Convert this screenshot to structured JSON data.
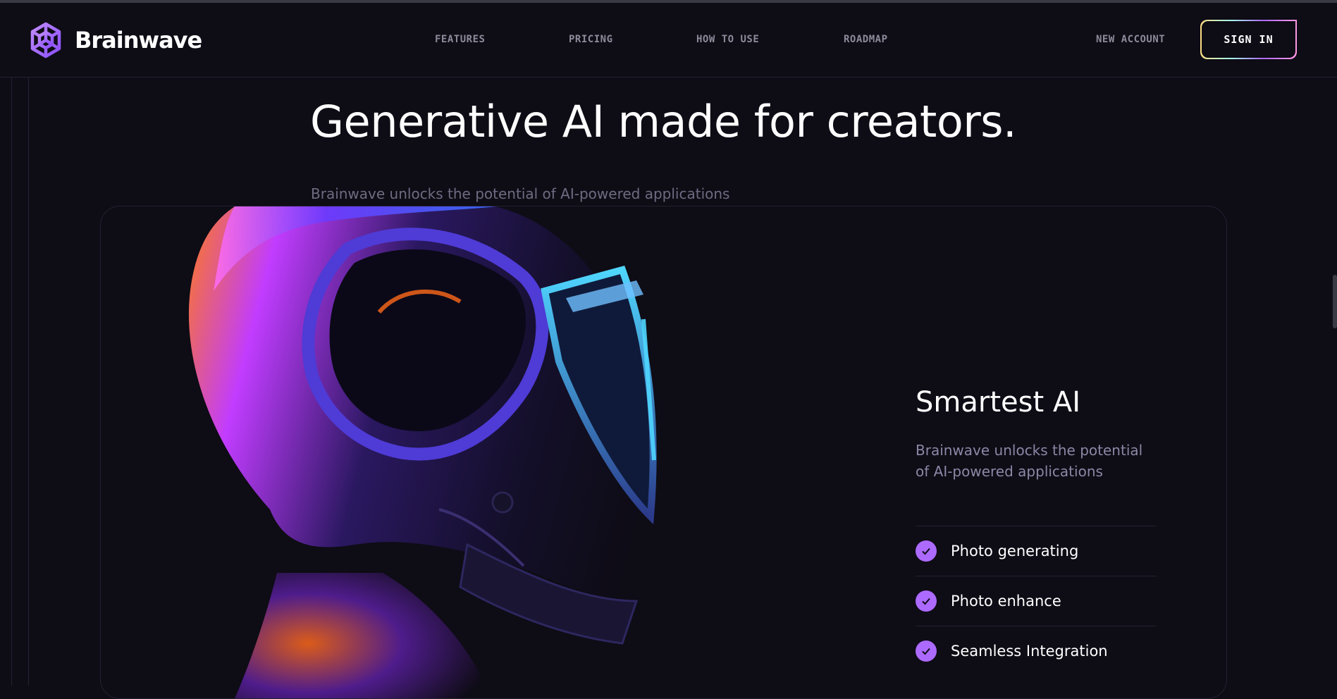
{
  "brand": {
    "name": "Brainwave",
    "accent": "#ac6aff"
  },
  "nav": {
    "items": [
      {
        "label": "FEATURES"
      },
      {
        "label": "PRICING"
      },
      {
        "label": "HOW TO USE"
      },
      {
        "label": "ROADMAP"
      }
    ],
    "new_account": "NEW ACCOUNT",
    "sign_in": "SIGN IN"
  },
  "hero": {
    "title": "Generative AI made for creators.",
    "subtitle": "Brainwave unlocks the potential of AI-powered applications"
  },
  "feature": {
    "title": "Smartest AI",
    "text": "Brainwave unlocks the potential of AI-powered applications",
    "items": [
      {
        "label": "Photo generating",
        "icon": "check-icon"
      },
      {
        "label": "Photo enhance",
        "icon": "check-icon"
      },
      {
        "label": "Seamless Integration",
        "icon": "check-icon"
      }
    ]
  },
  "colors": {
    "background": "#0e0c15",
    "accent": "#ac6aff",
    "muted_text": "#8c87a6",
    "border": "#252134"
  }
}
